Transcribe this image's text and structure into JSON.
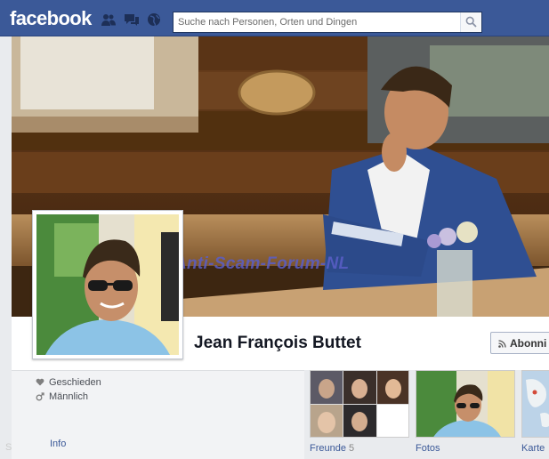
{
  "topbar": {
    "logo": "facebook",
    "search_placeholder": "Suche nach Personen, Orten und Dingen",
    "jewels": [
      "friend-requests-icon",
      "messages-icon",
      "notifications-globe-icon"
    ],
    "search_icon": "search-icon"
  },
  "cover": {
    "watermark": "Anti-Scam-Forum-NL"
  },
  "profile": {
    "name": "Jean François Buttet",
    "subscribe_label": "Abonni"
  },
  "info": {
    "items": [
      {
        "icon": "heart-icon",
        "label": "Geschieden"
      },
      {
        "icon": "male-icon",
        "label": "Männlich"
      }
    ],
    "tab_label": "Info",
    "faint_text": "S"
  },
  "apps": {
    "friends": {
      "label": "Freunde",
      "count": "5"
    },
    "photos": {
      "label": "Fotos"
    },
    "map": {
      "label": "Karte"
    }
  },
  "colors": {
    "brand_blue": "#3b5998",
    "watermark": "#5a5ec8"
  }
}
